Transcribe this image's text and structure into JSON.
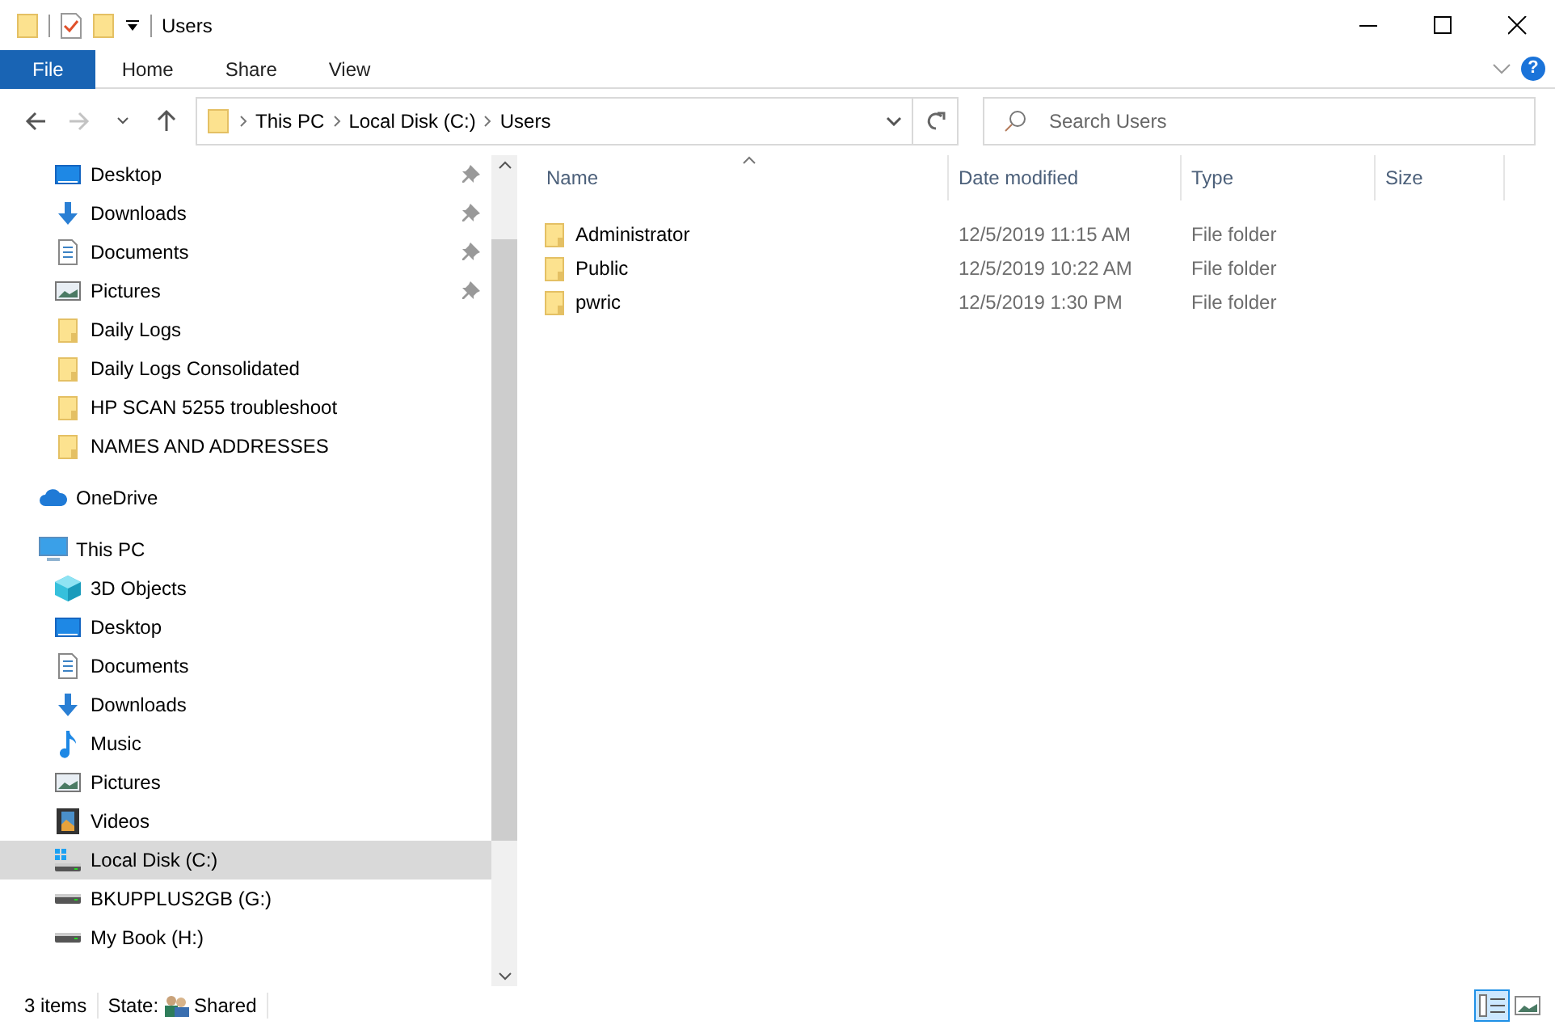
{
  "window": {
    "title": "Users"
  },
  "ribbon": {
    "help_label": "?",
    "tabs": [
      {
        "label": "File",
        "selected": true
      },
      {
        "label": "Home",
        "selected": false
      },
      {
        "label": "Share",
        "selected": false
      },
      {
        "label": "View",
        "selected": false
      }
    ]
  },
  "navigation": [
    {
      "kind": "back",
      "disabled": false
    },
    {
      "kind": "forward",
      "disabled": true
    },
    {
      "kind": "recent",
      "disabled": false
    },
    {
      "kind": "up",
      "disabled": false
    }
  ],
  "address": {
    "crumbs": [
      "This PC",
      "Local Disk (C:)",
      "Users"
    ]
  },
  "search": {
    "placeholder": "Search Users"
  },
  "sidebar": {
    "quick_access": [
      {
        "label": "Desktop",
        "kind": "desktop",
        "pinned": true,
        "selected": false
      },
      {
        "label": "Downloads",
        "kind": "download",
        "pinned": true,
        "selected": false
      },
      {
        "label": "Documents",
        "kind": "document",
        "pinned": true,
        "selected": false
      },
      {
        "label": "Pictures",
        "kind": "picture",
        "pinned": true,
        "selected": false
      },
      {
        "label": "Daily Logs",
        "kind": "folder",
        "pinned": false,
        "selected": false
      },
      {
        "label": "Daily Logs Consolidated",
        "kind": "folder",
        "pinned": false,
        "selected": false
      },
      {
        "label": "HP SCAN 5255 troubleshoot",
        "kind": "folder",
        "pinned": false,
        "selected": false
      },
      {
        "label": "NAMES AND ADDRESSES",
        "kind": "folder",
        "pinned": false,
        "selected": false
      }
    ],
    "items": [
      {
        "label": "OneDrive",
        "kind": "cloud",
        "selected": false
      },
      {
        "label": "This PC",
        "kind": "pc",
        "selected": false,
        "children": [
          {
            "label": "3D Objects",
            "kind": "cube",
            "selected": false
          },
          {
            "label": "Desktop",
            "kind": "desktop",
            "selected": false
          },
          {
            "label": "Documents",
            "kind": "document",
            "selected": false
          },
          {
            "label": "Downloads",
            "kind": "download",
            "selected": false
          },
          {
            "label": "Music",
            "kind": "music",
            "selected": false
          },
          {
            "label": "Pictures",
            "kind": "picture",
            "selected": false
          },
          {
            "label": "Videos",
            "kind": "video",
            "selected": false
          },
          {
            "label": "Local Disk (C:)",
            "kind": "system_disk",
            "selected": true
          },
          {
            "label": "BKUPPLUS2GB (G:)",
            "kind": "disk",
            "selected": false
          },
          {
            "label": "My Book (H:)",
            "kind": "disk",
            "selected": false
          }
        ]
      }
    ]
  },
  "file_list": {
    "columns": [
      {
        "label": "Name",
        "sorted": true
      },
      {
        "label": "Date modified",
        "sorted": false
      },
      {
        "label": "Type",
        "sorted": false
      },
      {
        "label": "Size",
        "sorted": false
      }
    ],
    "rows": [
      {
        "name": "Administrator",
        "date_modified": "12/5/2019 11:15 AM",
        "type": "File folder"
      },
      {
        "name": "Public",
        "date_modified": "12/5/2019 10:22 AM",
        "type": "File folder"
      },
      {
        "name": "pwric",
        "date_modified": "12/5/2019 1:30 PM",
        "type": "File folder"
      }
    ]
  },
  "status_bar": {
    "item_count": "3 items",
    "state_label": "State:",
    "state_value": "Shared"
  },
  "view_buttons": [
    {
      "kind": "details",
      "selected": true
    },
    {
      "kind": "large_icons",
      "selected": false
    }
  ]
}
